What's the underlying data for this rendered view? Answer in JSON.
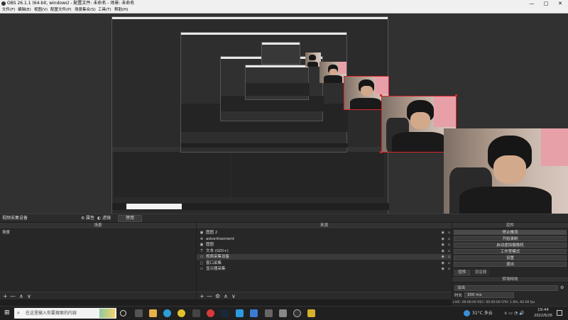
{
  "window": {
    "title": "OBS 26.1.1 (64-bit, windows) - 配置文件: 未命名 - 场景: 未命名",
    "minimize": "—",
    "maximize": "□",
    "close": "✕"
  },
  "menu": [
    "文件(F)",
    "编辑(E)",
    "视图(V)",
    "配置文件(P)",
    "场景集合(S)",
    "工具(T)",
    "帮助(H)"
  ],
  "source_toolbar": {
    "current_source": "视频采集设备",
    "properties": "属性",
    "filters": "滤镜",
    "deactivate": "停用"
  },
  "scenes": {
    "header": "场景",
    "items": [
      "场景"
    ],
    "footer": [
      "+",
      "—",
      "∧",
      "∨"
    ]
  },
  "sources": {
    "header": "来源",
    "items": [
      {
        "icon": "image-icon",
        "glyph": "▣",
        "name": "图图 2"
      },
      {
        "icon": "browser-icon",
        "glyph": "⊕",
        "name": "advertisement"
      },
      {
        "icon": "image-icon",
        "glyph": "▣",
        "name": "图图"
      },
      {
        "icon": "text-icon",
        "glyph": "T",
        "name": "文本 (GDI+)"
      },
      {
        "icon": "camera-icon",
        "glyph": "▭",
        "name": "视频采集设备"
      },
      {
        "icon": "window-icon",
        "glyph": "▢",
        "name": "窗口采集"
      },
      {
        "icon": "monitor-icon",
        "glyph": "▭",
        "name": "显示器采集"
      }
    ],
    "footer": [
      "+",
      "—",
      "⚙",
      "∧",
      "∨"
    ]
  },
  "controls": {
    "header": "控件",
    "buttons": [
      "停止推流",
      "开始录制",
      "启动虚拟摄像机",
      "工作室模式",
      "设置",
      "退出"
    ]
  },
  "right_tabs": [
    "控件",
    "混音器"
  ],
  "transition": {
    "header": "转场特效",
    "selected": "淡出",
    "duration_label": "时长",
    "duration_value": "300 ms"
  },
  "statusbar": "LIVE: 00:00:00   REC: 00:00:00   CPU: 1.8%, 60.00 fps",
  "taskbar": {
    "search_placeholder": "在这里输入你要搜索的内容",
    "weather": "31°C 多云",
    "time": "19:44",
    "date": "2022/6/26"
  },
  "colors": {
    "selection": "#d8262e",
    "obs_dark": "#272727",
    "highlight_row": "#3a3a3a"
  }
}
